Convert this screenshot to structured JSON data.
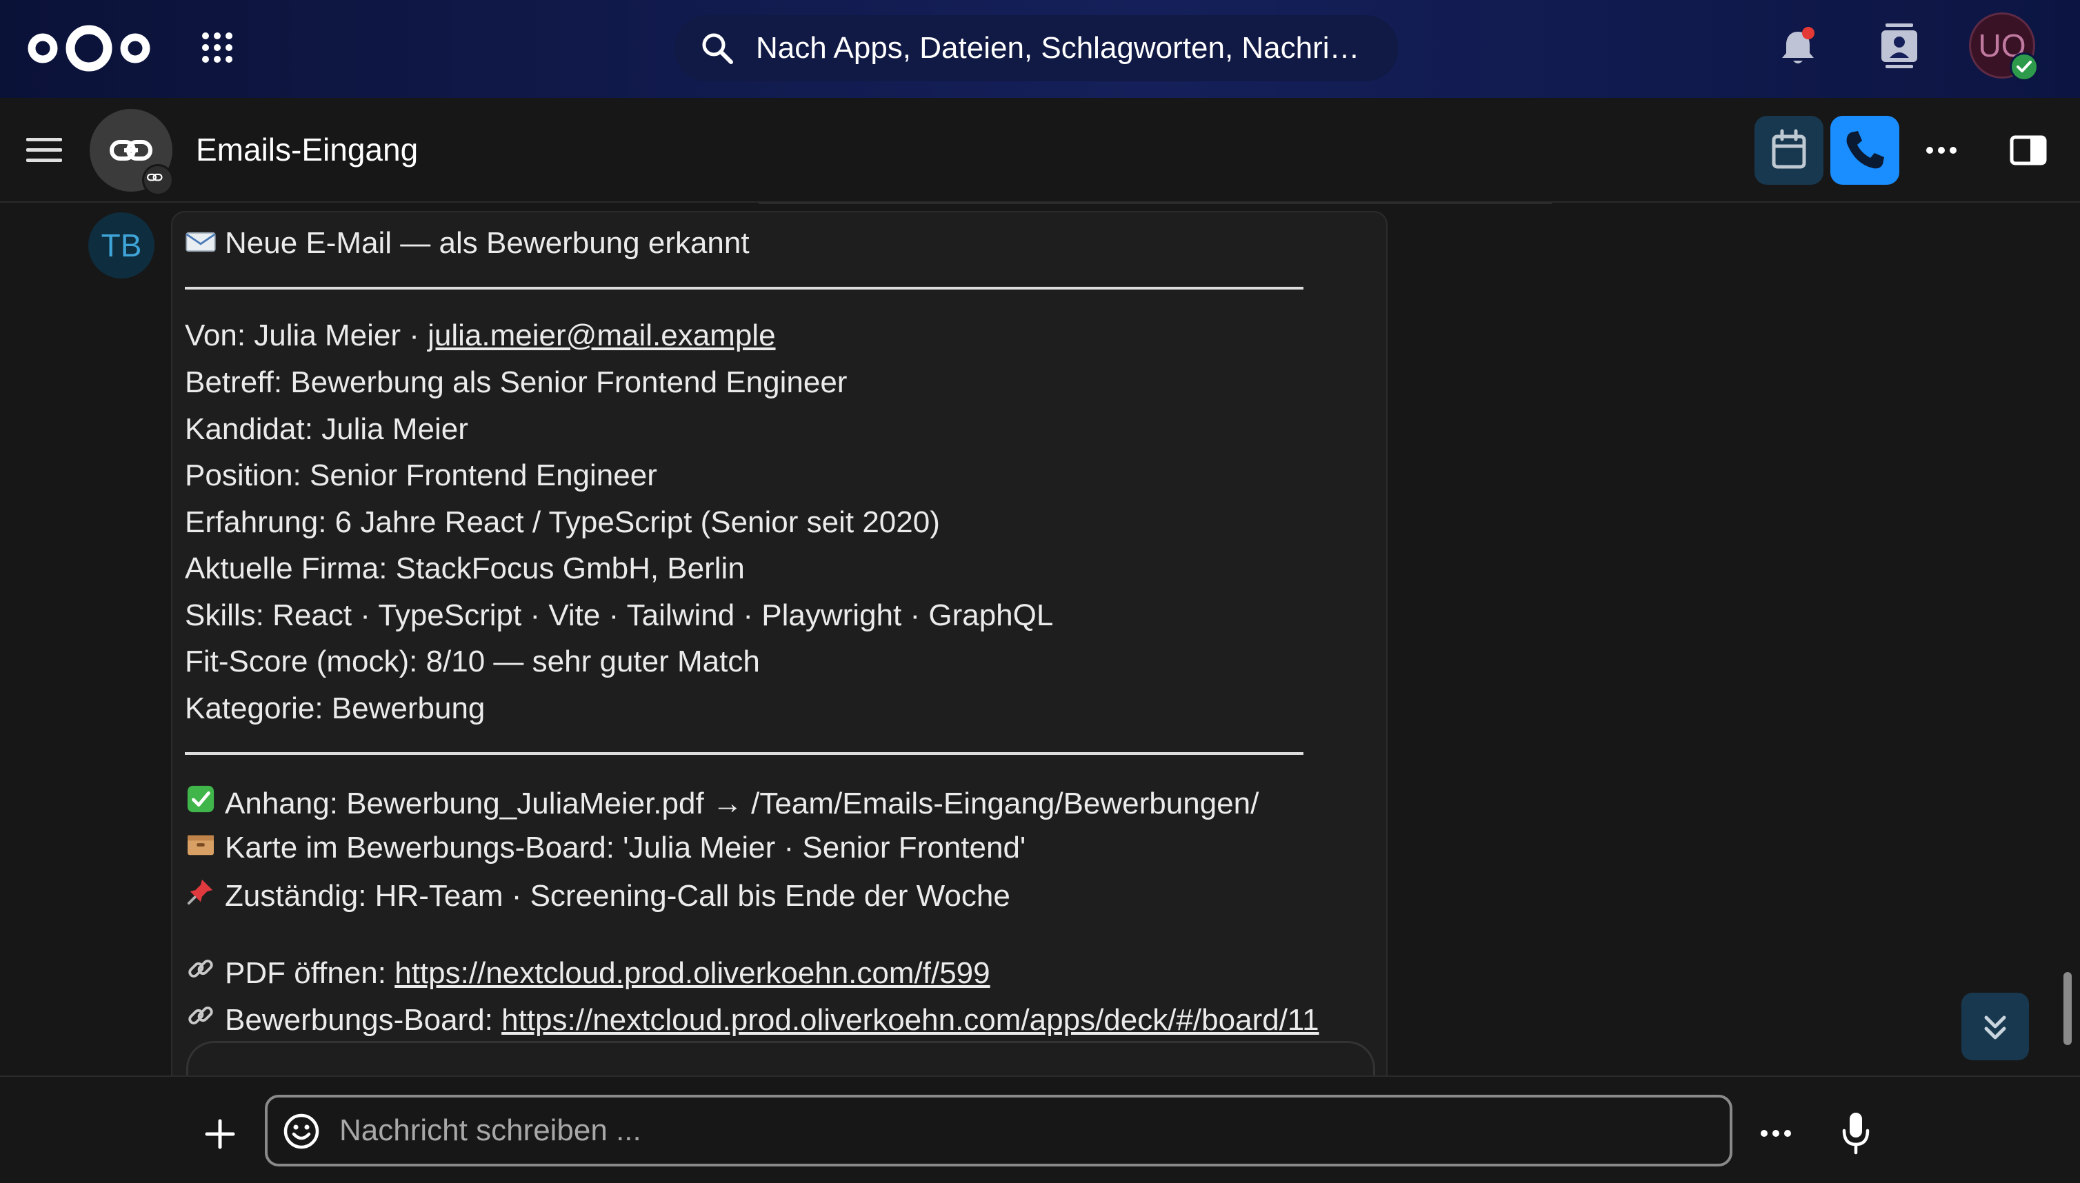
{
  "header": {
    "logo": "nextcloud-logo",
    "search_placeholder": "Nach Apps, Dateien, Schlagworten, Nachri…",
    "user_initials": "UO"
  },
  "conversation": {
    "title": "Emails-Eingang"
  },
  "message": {
    "author_initials": "TB",
    "heading": "Neue E-Mail — als Bewerbung erkannt",
    "from_prefix": "Von: Julia Meier · ",
    "from_email": "julia.meier@mail.example",
    "lines": [
      "Betreff: Bewerbung als Senior Frontend Engineer",
      "Kandidat: Julia Meier",
      "Position: Senior Frontend Engineer",
      "Erfahrung: 6 Jahre React / TypeScript (Senior seit 2020)",
      "Aktuelle Firma: StackFocus GmbH, Berlin",
      "Skills: React · TypeScript · Vite · Tailwind · Playwright · GraphQL",
      "Fit-Score (mock): 8/10 — sehr guter Match",
      "Kategorie: Bewerbung"
    ],
    "attachment": "Anhang: Bewerbung_JuliaMeier.pdf → /Team/Emails-Eingang/Bewerbungen/",
    "card": "Karte im Bewerbungs-Board: 'Julia Meier · Senior Frontend'",
    "assignee": "Zuständig: HR-Team · Screening-Call bis Ende der Woche",
    "pdf_label": "PDF öffnen: ",
    "pdf_url": "https://nextcloud.prod.oliverkoehn.com/f/599",
    "board_label": "Bewerbungs-Board: ",
    "board_url": "https://nextcloud.prod.oliverkoehn.com/apps/deck/#/board/11"
  },
  "composer": {
    "placeholder": "Nachricht schreiben ..."
  },
  "colors": {
    "header_bg": "#15205a",
    "call_button": "#1a8dff",
    "calendar_button": "#18384f",
    "status_online": "#2d9a4c"
  }
}
